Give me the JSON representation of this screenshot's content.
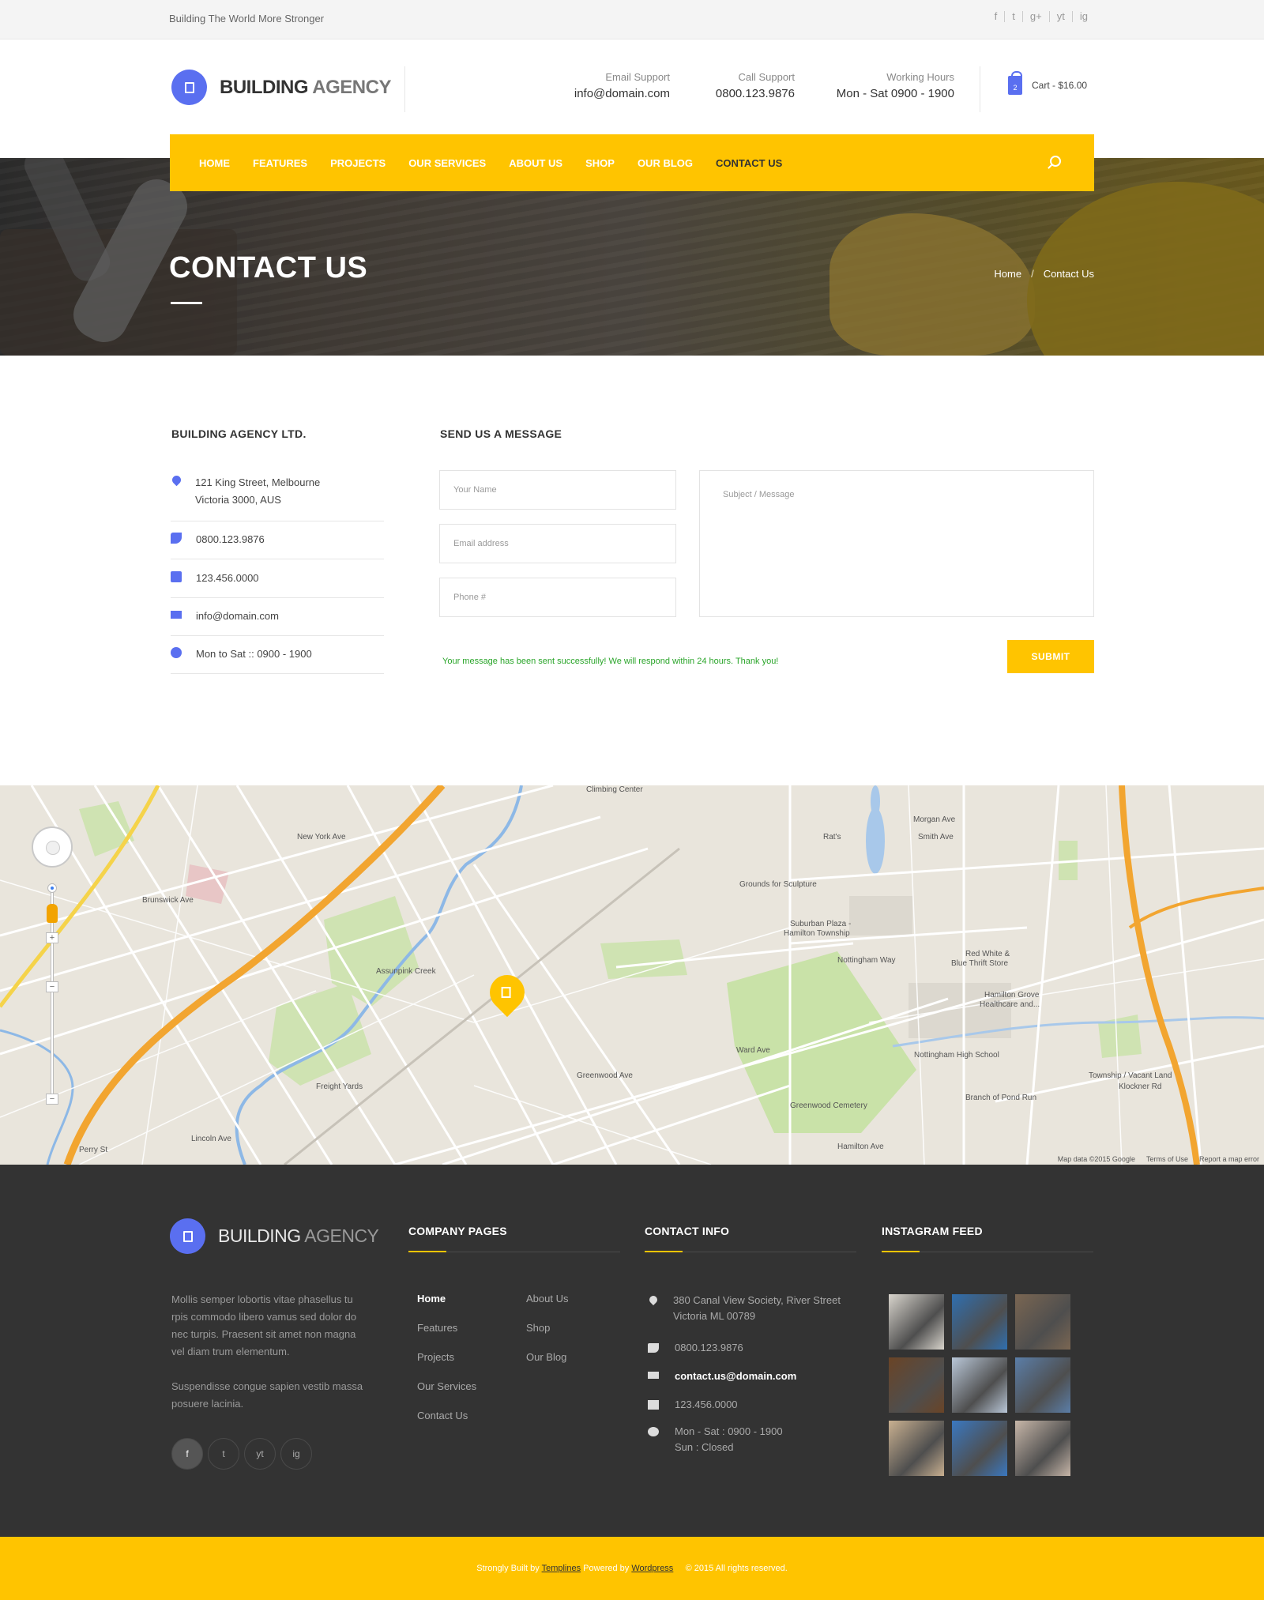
{
  "topbar": {
    "tagline": "Building The World More Stronger",
    "social": [
      "f",
      "t",
      "g+",
      "yt",
      "ig"
    ]
  },
  "header": {
    "logo_bold": "BUILDING",
    "logo_light": "AGENCY",
    "email_label": "Email Support",
    "email_value": "info@domain.com",
    "call_label": "Call Support",
    "call_value": "0800.123.9876",
    "hours_label": "Working Hours",
    "hours_value": "Mon - Sat 0900 - 1900",
    "cart_count": "2",
    "cart_label": "Cart - $16.00"
  },
  "nav": {
    "items": [
      "HOME",
      "FEATURES",
      "PROJECTS",
      "OUR SERVICES",
      "ABOUT US",
      "SHOP",
      "OUR BLOG",
      "CONTACT US"
    ]
  },
  "hero": {
    "title": "CONTACT US",
    "breadcrumb_home": "Home",
    "breadcrumb_sep": "/",
    "breadcrumb_current": "Contact Us"
  },
  "contact": {
    "company_title": "BUILDING AGENCY LTD.",
    "address_line1": "121 King Street, Melbourne",
    "address_line2": "Victoria 3000, AUS",
    "phone": "0800.123.9876",
    "fax": "123.456.0000",
    "email": "info@domain.com",
    "hours": "Mon to Sat  ::  0900 - 1900",
    "form_title": "SEND US A MESSAGE",
    "name_placeholder": "Your Name",
    "email_placeholder": "Email address",
    "phone_placeholder": "Phone #",
    "message_placeholder": "Subject / Message",
    "success_message": "Your message has been sent successfully! We will respond within 24 hours. Thank you!",
    "submit_label": "SUBMIT"
  },
  "map": {
    "labels": [
      "Climbing Center",
      "Rat's",
      "Grounds for Sculpture",
      "Suburban Plaza -",
      "Hamilton Township",
      "Nottingham Way",
      "Red White &",
      "Blue Thrift Store",
      "Hamilton Grove",
      "Healthcare and...",
      "Nottingham High School",
      "Greenwood Cemetery",
      "Freight Yards",
      "Township / Vacant Land",
      "Klockner Rd",
      "Branch of Pond Run",
      "Brunswick Ave",
      "New York Ave",
      "Greenwood Ave",
      "Hamilton Ave",
      "Lincoln Ave",
      "Perry St",
      "Assunpink Creek",
      "Ward Ave",
      "Morgan Ave",
      "Smith Ave"
    ],
    "attribution": [
      "Map data ©2015 Google",
      "Terms of Use",
      "Report a map error"
    ]
  },
  "footer": {
    "logo_bold": "BUILDING",
    "logo_light": "AGENCY",
    "about_p1": "Mollis semper lobortis vitae phasellus tu rpis commodo libero vamus sed dolor do nec turpis. Praesent sit amet non magna vel diam trum elementum.",
    "about_p2": "Suspendisse congue sapien vestib massa posuere lacinia.",
    "social": [
      "f",
      "t",
      "yt",
      "ig"
    ],
    "pages_title": "COMPANY PAGES",
    "pages_col1": [
      "Home",
      "Features",
      "Projects",
      "Our Services",
      "Contact Us"
    ],
    "pages_col2": [
      "About Us",
      "Shop",
      "Our Blog"
    ],
    "contact_title": "CONTACT INFO",
    "contact_address1": "380 Canal View Society, River Street",
    "contact_address2": "Victoria ML 00789",
    "contact_phone": "0800.123.9876",
    "contact_email": "contact.us@domain.com",
    "contact_fax": "123.456.0000",
    "contact_hours1": "Mon - Sat : 0900 - 1900",
    "contact_hours2": "Sun : Closed",
    "insta_title": "INSTAGRAM FEED",
    "insta_colors": [
      "#d8d4cc",
      "#2f6fb0",
      "#7a6652",
      "#6a4426",
      "#b9c7d8",
      "#5b7ea8",
      "#c9b090",
      "#3a78c0",
      "#c7b6a8"
    ]
  },
  "bottom": {
    "built_by": "Strongly Built by",
    "templines": "Templines",
    "powered_by": "Powered by",
    "wordpress": "Wordpress",
    "copyright": "© 2015 All rights reserved."
  },
  "colors": {
    "accent": "#ffc400",
    "brand_blue": "#5a6ff0",
    "footer_bg": "#333333",
    "success": "#2aa52a"
  }
}
